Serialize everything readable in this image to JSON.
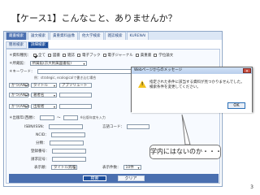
{
  "slide": {
    "title": "【ケース1】こんなこと、ありませんか？",
    "page_number": "3",
    "callout": "学内にはないのか・・・"
  },
  "app": {
    "tabs": [
      {
        "label": "蔵書検索"
      },
      {
        "label": "論文検索"
      },
      {
        "label": "貴重資料画像"
      },
      {
        "label": "他大学検索"
      },
      {
        "label": "雑誌検索"
      },
      {
        "label": "KURENAI"
      }
    ],
    "subtabs": [
      {
        "label": "簡易検索"
      },
      {
        "label": "詳細検索"
      }
    ]
  },
  "form": {
    "material_label": "＊資料種別：",
    "materials": [
      {
        "label": "全て",
        "checked": true
      },
      {
        "label": "図書",
        "checked": false
      },
      {
        "label": "雑誌",
        "checked": false
      },
      {
        "label": "電子ブック",
        "checked": false
      },
      {
        "label": "電子ジャーナル",
        "checked": false
      },
      {
        "label": "貴重書",
        "checked": false
      },
      {
        "label": "学位論文",
        "checked": false
      }
    ],
    "location_label": "＊所蔵館：",
    "location_value": "所属館(京大附属図書館)",
    "keyword_label": "＊キーワード：",
    "keyword_value": "",
    "keyword_note": "例：strategic, ecologicalで書き込む場合",
    "and_label": "かつ(AND)",
    "field_title": "タイトル",
    "title_value": "アブソリュート",
    "field_author": "著者名",
    "author_value": "",
    "field_publisher": "出版者",
    "publisher_value": "",
    "year_label": "＊出版年(西暦)：",
    "year_note": "※出版年度を入力",
    "isbn_label": "ISBN/ISSN：",
    "ncid_label": "NCID：",
    "lang_label": "言語コード：",
    "class_label": "分類：",
    "reg_label": "登録番号：",
    "place_label": "請求記号：",
    "sort_label": "表示順：",
    "sort_value": "タイトル昇順",
    "count_label": "表示件数：",
    "count_value": "10件",
    "search_button": "検索",
    "clear_button": "クリア"
  },
  "dialog": {
    "title": "Webページからのメッセージ",
    "message_line1": "指定された条件に該当する資料が見つかりませんでした。",
    "message_line2": "検索条件を変更してください。",
    "ok_button": "OK",
    "close_glyph": "×",
    "warning_mark": "!"
  },
  "colors": {
    "accent": "#4a6fb0",
    "dark_accent": "#1f4f9c"
  }
}
